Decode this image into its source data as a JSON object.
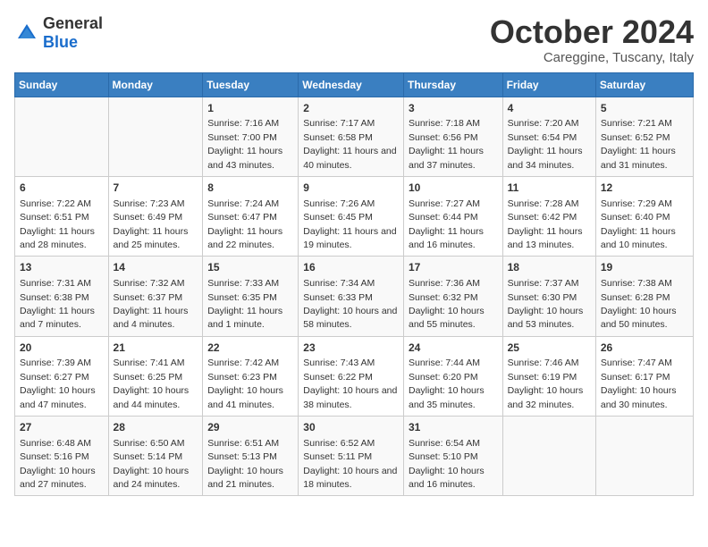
{
  "logo": {
    "general": "General",
    "blue": "Blue"
  },
  "header": {
    "month": "October 2024",
    "location": "Careggine, Tuscany, Italy"
  },
  "weekdays": [
    "Sunday",
    "Monday",
    "Tuesday",
    "Wednesday",
    "Thursday",
    "Friday",
    "Saturday"
  ],
  "weeks": [
    [
      {
        "day": "",
        "sunrise": "",
        "sunset": "",
        "daylight": ""
      },
      {
        "day": "",
        "sunrise": "",
        "sunset": "",
        "daylight": ""
      },
      {
        "day": "1",
        "sunrise": "Sunrise: 7:16 AM",
        "sunset": "Sunset: 7:00 PM",
        "daylight": "Daylight: 11 hours and 43 minutes."
      },
      {
        "day": "2",
        "sunrise": "Sunrise: 7:17 AM",
        "sunset": "Sunset: 6:58 PM",
        "daylight": "Daylight: 11 hours and 40 minutes."
      },
      {
        "day": "3",
        "sunrise": "Sunrise: 7:18 AM",
        "sunset": "Sunset: 6:56 PM",
        "daylight": "Daylight: 11 hours and 37 minutes."
      },
      {
        "day": "4",
        "sunrise": "Sunrise: 7:20 AM",
        "sunset": "Sunset: 6:54 PM",
        "daylight": "Daylight: 11 hours and 34 minutes."
      },
      {
        "day": "5",
        "sunrise": "Sunrise: 7:21 AM",
        "sunset": "Sunset: 6:52 PM",
        "daylight": "Daylight: 11 hours and 31 minutes."
      }
    ],
    [
      {
        "day": "6",
        "sunrise": "Sunrise: 7:22 AM",
        "sunset": "Sunset: 6:51 PM",
        "daylight": "Daylight: 11 hours and 28 minutes."
      },
      {
        "day": "7",
        "sunrise": "Sunrise: 7:23 AM",
        "sunset": "Sunset: 6:49 PM",
        "daylight": "Daylight: 11 hours and 25 minutes."
      },
      {
        "day": "8",
        "sunrise": "Sunrise: 7:24 AM",
        "sunset": "Sunset: 6:47 PM",
        "daylight": "Daylight: 11 hours and 22 minutes."
      },
      {
        "day": "9",
        "sunrise": "Sunrise: 7:26 AM",
        "sunset": "Sunset: 6:45 PM",
        "daylight": "Daylight: 11 hours and 19 minutes."
      },
      {
        "day": "10",
        "sunrise": "Sunrise: 7:27 AM",
        "sunset": "Sunset: 6:44 PM",
        "daylight": "Daylight: 11 hours and 16 minutes."
      },
      {
        "day": "11",
        "sunrise": "Sunrise: 7:28 AM",
        "sunset": "Sunset: 6:42 PM",
        "daylight": "Daylight: 11 hours and 13 minutes."
      },
      {
        "day": "12",
        "sunrise": "Sunrise: 7:29 AM",
        "sunset": "Sunset: 6:40 PM",
        "daylight": "Daylight: 11 hours and 10 minutes."
      }
    ],
    [
      {
        "day": "13",
        "sunrise": "Sunrise: 7:31 AM",
        "sunset": "Sunset: 6:38 PM",
        "daylight": "Daylight: 11 hours and 7 minutes."
      },
      {
        "day": "14",
        "sunrise": "Sunrise: 7:32 AM",
        "sunset": "Sunset: 6:37 PM",
        "daylight": "Daylight: 11 hours and 4 minutes."
      },
      {
        "day": "15",
        "sunrise": "Sunrise: 7:33 AM",
        "sunset": "Sunset: 6:35 PM",
        "daylight": "Daylight: 11 hours and 1 minute."
      },
      {
        "day": "16",
        "sunrise": "Sunrise: 7:34 AM",
        "sunset": "Sunset: 6:33 PM",
        "daylight": "Daylight: 10 hours and 58 minutes."
      },
      {
        "day": "17",
        "sunrise": "Sunrise: 7:36 AM",
        "sunset": "Sunset: 6:32 PM",
        "daylight": "Daylight: 10 hours and 55 minutes."
      },
      {
        "day": "18",
        "sunrise": "Sunrise: 7:37 AM",
        "sunset": "Sunset: 6:30 PM",
        "daylight": "Daylight: 10 hours and 53 minutes."
      },
      {
        "day": "19",
        "sunrise": "Sunrise: 7:38 AM",
        "sunset": "Sunset: 6:28 PM",
        "daylight": "Daylight: 10 hours and 50 minutes."
      }
    ],
    [
      {
        "day": "20",
        "sunrise": "Sunrise: 7:39 AM",
        "sunset": "Sunset: 6:27 PM",
        "daylight": "Daylight: 10 hours and 47 minutes."
      },
      {
        "day": "21",
        "sunrise": "Sunrise: 7:41 AM",
        "sunset": "Sunset: 6:25 PM",
        "daylight": "Daylight: 10 hours and 44 minutes."
      },
      {
        "day": "22",
        "sunrise": "Sunrise: 7:42 AM",
        "sunset": "Sunset: 6:23 PM",
        "daylight": "Daylight: 10 hours and 41 minutes."
      },
      {
        "day": "23",
        "sunrise": "Sunrise: 7:43 AM",
        "sunset": "Sunset: 6:22 PM",
        "daylight": "Daylight: 10 hours and 38 minutes."
      },
      {
        "day": "24",
        "sunrise": "Sunrise: 7:44 AM",
        "sunset": "Sunset: 6:20 PM",
        "daylight": "Daylight: 10 hours and 35 minutes."
      },
      {
        "day": "25",
        "sunrise": "Sunrise: 7:46 AM",
        "sunset": "Sunset: 6:19 PM",
        "daylight": "Daylight: 10 hours and 32 minutes."
      },
      {
        "day": "26",
        "sunrise": "Sunrise: 7:47 AM",
        "sunset": "Sunset: 6:17 PM",
        "daylight": "Daylight: 10 hours and 30 minutes."
      }
    ],
    [
      {
        "day": "27",
        "sunrise": "Sunrise: 6:48 AM",
        "sunset": "Sunset: 5:16 PM",
        "daylight": "Daylight: 10 hours and 27 minutes."
      },
      {
        "day": "28",
        "sunrise": "Sunrise: 6:50 AM",
        "sunset": "Sunset: 5:14 PM",
        "daylight": "Daylight: 10 hours and 24 minutes."
      },
      {
        "day": "29",
        "sunrise": "Sunrise: 6:51 AM",
        "sunset": "Sunset: 5:13 PM",
        "daylight": "Daylight: 10 hours and 21 minutes."
      },
      {
        "day": "30",
        "sunrise": "Sunrise: 6:52 AM",
        "sunset": "Sunset: 5:11 PM",
        "daylight": "Daylight: 10 hours and 18 minutes."
      },
      {
        "day": "31",
        "sunrise": "Sunrise: 6:54 AM",
        "sunset": "Sunset: 5:10 PM",
        "daylight": "Daylight: 10 hours and 16 minutes."
      },
      {
        "day": "",
        "sunrise": "",
        "sunset": "",
        "daylight": ""
      },
      {
        "day": "",
        "sunrise": "",
        "sunset": "",
        "daylight": ""
      }
    ]
  ]
}
